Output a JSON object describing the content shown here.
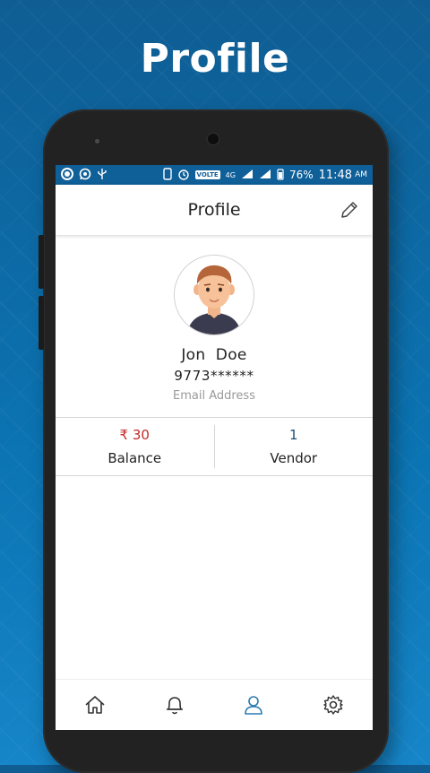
{
  "promo": {
    "title": "Profile"
  },
  "status_bar": {
    "battery": "76%",
    "time": "11:48",
    "ampm": "AM",
    "volte": "VOLTE",
    "network": "4G"
  },
  "header": {
    "title": "Profile"
  },
  "user": {
    "name": "Jon  Doe",
    "phone": "9773******",
    "email": "Email Address"
  },
  "stats": [
    {
      "value": "₹ 30",
      "label": "Balance",
      "value_color": "#c62828"
    },
    {
      "value": "1",
      "label": "Vendor",
      "value_color": "#1b4f72"
    }
  ],
  "bottom_nav": [
    {
      "name": "home-icon",
      "active": false
    },
    {
      "name": "bell-icon",
      "active": false
    },
    {
      "name": "user-icon",
      "active": true
    },
    {
      "name": "settings-icon",
      "active": false
    }
  ],
  "colors": {
    "accent": "#0f5f98",
    "nav_active": "#2a7ab0",
    "nav_inactive": "#333333"
  }
}
